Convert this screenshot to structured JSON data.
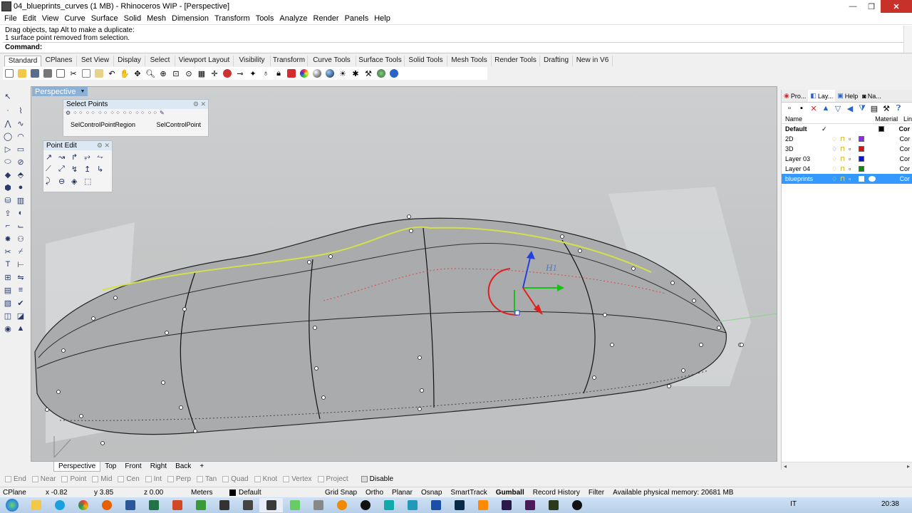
{
  "window": {
    "title": "04_blueprints_curves (1 MB) - Rhinoceros WIP - [Perspective]",
    "min": "—",
    "max": "❐",
    "close": "✕"
  },
  "menu": [
    "File",
    "Edit",
    "View",
    "Curve",
    "Surface",
    "Solid",
    "Mesh",
    "Dimension",
    "Transform",
    "Tools",
    "Analyze",
    "Render",
    "Panels",
    "Help"
  ],
  "command": {
    "history_1": "Drag objects, tap Alt to make a duplicate:",
    "history_2": "1 surface point removed from selection.",
    "prompt": "Command:"
  },
  "toolbar_tabs": [
    "Standard",
    "CPlanes",
    "Set View",
    "Display",
    "Select",
    "Viewport Layout",
    "Visibility",
    "Transform",
    "Curve Tools",
    "Surface Tools",
    "Solid Tools",
    "Mesh Tools",
    "Render Tools",
    "Drafting",
    "New in V6"
  ],
  "toolbar_icons": [
    "new-icon",
    "open-icon",
    "save-icon",
    "print-icon",
    "import-icon",
    "cut-icon",
    "copy-icon",
    "paste-icon",
    "undo-icon",
    "pan-icon",
    "rotate-icon",
    "zoom-icon",
    "zoom-window-icon",
    "zoom-extents-icon",
    "zoom-selected-icon",
    "grid-icon",
    "move-icon",
    "gumball-icon",
    "snap-icon",
    "light-icon",
    "lock-icon",
    "shade-icon",
    "render-icon",
    "sphere-icon",
    "material-icon",
    "texture-icon",
    "point-icon",
    "wand-icon",
    "globe-icon",
    "help-icon"
  ],
  "viewport": {
    "label": "Perspective",
    "dropdown": "▼",
    "gumball_label": "H1"
  },
  "select_points_panel": {
    "title": "Select Points",
    "btn1": "SelControlPointRegion",
    "btn2": "SelControlPoint"
  },
  "point_edit_panel": {
    "title": "Point Edit"
  },
  "viewport_tabs": [
    "Perspective",
    "Top",
    "Front",
    "Right",
    "Back",
    "+"
  ],
  "right_panel": {
    "tabs": [
      "Pro...",
      "Lay...",
      "Help",
      "Na..."
    ],
    "headers": {
      "name": "Name",
      "material": "Material",
      "linetype": "Lin"
    },
    "layers": [
      {
        "name": "Default",
        "current": "✓",
        "color": "#000000",
        "bold": true,
        "lt": "Cor"
      },
      {
        "name": "2D",
        "color": "#8b2be2",
        "lt": "Cor"
      },
      {
        "name": "3D",
        "color": "#d41414",
        "lt": "Cor"
      },
      {
        "name": "Layer 03",
        "color": "#0a14d8",
        "lt": "Cor"
      },
      {
        "name": "Layer 04",
        "color": "#0e8a14",
        "lt": "Cor"
      },
      {
        "name": "blueprints",
        "color": "#ffffff",
        "lt": "Cor",
        "selected": true
      }
    ]
  },
  "osnaps": [
    "End",
    "Near",
    "Point",
    "Mid",
    "Cen",
    "Int",
    "Perp",
    "Tan",
    "Quad",
    "Knot",
    "Vertex",
    "Project",
    "Disable"
  ],
  "status": {
    "cplane": "CPlane",
    "x": "x -0.82",
    "y": "y 3.85",
    "z": "z 0.00",
    "units": "Meters",
    "layer": "Default",
    "grid_snap": "Grid Snap",
    "ortho": "Ortho",
    "planar": "Planar",
    "osnap": "Osnap",
    "smarttrack": "SmartTrack",
    "gumball": "Gumball",
    "record_history": "Record History",
    "filter": "Filter",
    "memory": "Available physical memory: 20681 MB"
  },
  "taskbar": {
    "lang": "IT",
    "time": "20:38"
  }
}
